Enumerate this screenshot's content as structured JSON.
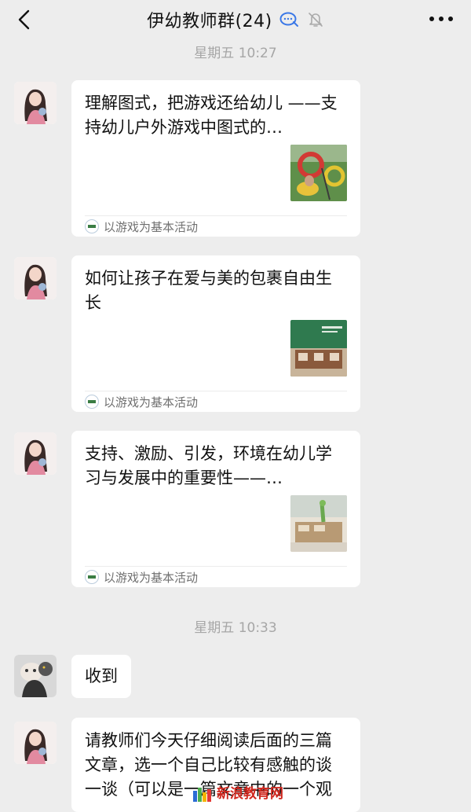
{
  "header": {
    "title": "伊幼教师群(24)",
    "back_icon": "chevron-left-icon",
    "more_icon": "more-dots-icon"
  },
  "timestamps": [
    "星期五 10:27",
    "星期五 10:33"
  ],
  "messages": [
    {
      "type": "article",
      "title": "理解图式，把游戏还给幼儿 ——支持幼儿户外游戏中图式的…",
      "source": "以游戏为基本活动"
    },
    {
      "type": "article",
      "title": "如何让孩子在爱与美的包裹自由生长",
      "source": "以游戏为基本活动"
    },
    {
      "type": "article",
      "title": "支持、激励、引发，环境在幼儿学习与发展中的重要性——…",
      "source": "以游戏为基本活动"
    },
    {
      "type": "text",
      "text": "收到"
    },
    {
      "type": "text",
      "text": "请教师们今天仔细阅读后面的三篇文章，选一个自己比较有感触的谈一谈（可以是一篇文章中的一个观"
    }
  ],
  "watermark": {
    "text": "新浪教育网"
  },
  "colors": {
    "background": "#ededed",
    "bubble": "#ffffff",
    "timestamp": "#a6a6a6",
    "watermark": "#d0281f"
  }
}
